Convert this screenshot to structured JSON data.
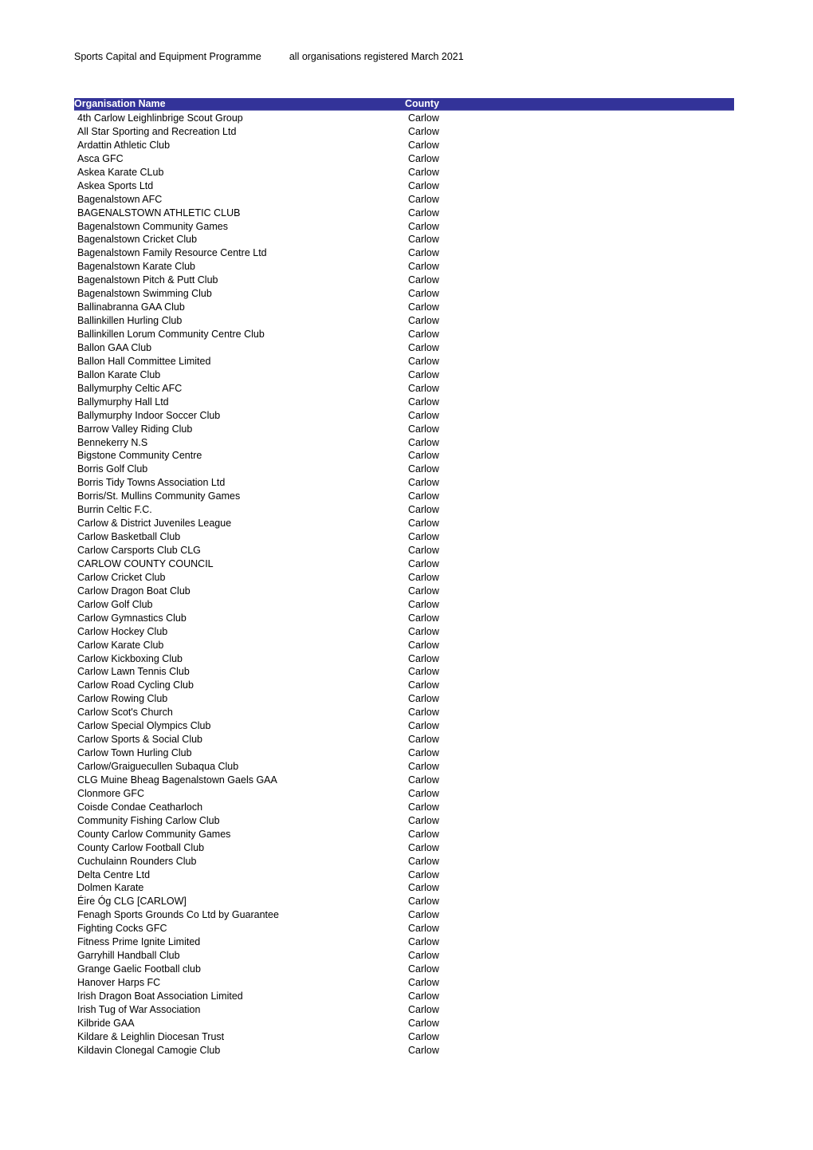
{
  "document": {
    "title_main": "Sports Capital and Equipment Programme",
    "title_sub": "all organisations registered March 2021",
    "accent_color": "#333399",
    "header_text_color": "#ffffff",
    "body_text_color": "#000000",
    "page_background": "#ffffff"
  },
  "table": {
    "columns": [
      {
        "key": "organisation",
        "label": "Organisation Name"
      },
      {
        "key": "county",
        "label": "County"
      }
    ],
    "row_count": 72,
    "rows": [
      {
        "organisation": "4th Carlow Leighlinbrige Scout Group",
        "county": "Carlow"
      },
      {
        "organisation": "All Star Sporting and Recreation Ltd",
        "county": "Carlow"
      },
      {
        "organisation": "Ardattin Athletic Club",
        "county": "Carlow"
      },
      {
        "organisation": "Asca GFC",
        "county": "Carlow"
      },
      {
        "organisation": "Askea Karate CLub",
        "county": "Carlow"
      },
      {
        "organisation": "Askea Sports Ltd",
        "county": "Carlow"
      },
      {
        "organisation": "Bagenalstown AFC",
        "county": "Carlow"
      },
      {
        "organisation": "BAGENALSTOWN ATHLETIC CLUB",
        "county": "Carlow"
      },
      {
        "organisation": "Bagenalstown Community Games",
        "county": "Carlow"
      },
      {
        "organisation": "Bagenalstown Cricket Club",
        "county": "Carlow"
      },
      {
        "organisation": "Bagenalstown Family Resource Centre Ltd",
        "county": "Carlow"
      },
      {
        "organisation": "Bagenalstown Karate Club",
        "county": "Carlow"
      },
      {
        "organisation": "Bagenalstown Pitch & Putt Club",
        "county": "Carlow"
      },
      {
        "organisation": "Bagenalstown Swimming Club",
        "county": "Carlow"
      },
      {
        "organisation": "Ballinabranna GAA Club",
        "county": "Carlow"
      },
      {
        "organisation": "Ballinkillen Hurling Club",
        "county": "Carlow"
      },
      {
        "organisation": "Ballinkillen Lorum Community Centre Club",
        "county": "Carlow"
      },
      {
        "organisation": "Ballon GAA Club",
        "county": "Carlow"
      },
      {
        "organisation": "Ballon Hall Committee Limited",
        "county": "Carlow"
      },
      {
        "organisation": "Ballon Karate Club",
        "county": "Carlow"
      },
      {
        "organisation": "Ballymurphy Celtic AFC",
        "county": "Carlow"
      },
      {
        "organisation": "Ballymurphy Hall Ltd",
        "county": "Carlow"
      },
      {
        "organisation": "Ballymurphy Indoor Soccer Club",
        "county": "Carlow"
      },
      {
        "organisation": "Barrow Valley Riding Club",
        "county": "Carlow"
      },
      {
        "organisation": "Bennekerry N.S",
        "county": "Carlow"
      },
      {
        "organisation": "Bigstone Community Centre",
        "county": "Carlow"
      },
      {
        "organisation": "Borris Golf Club",
        "county": "Carlow"
      },
      {
        "organisation": "Borris Tidy Towns Association Ltd",
        "county": "Carlow"
      },
      {
        "organisation": "Borris/St. Mullins Community Games",
        "county": "Carlow"
      },
      {
        "organisation": "Burrin Celtic F.C.",
        "county": "Carlow"
      },
      {
        "organisation": "Carlow & District Juveniles League",
        "county": "Carlow"
      },
      {
        "organisation": "Carlow Basketball Club",
        "county": "Carlow"
      },
      {
        "organisation": "Carlow Carsports Club CLG",
        "county": "Carlow"
      },
      {
        "organisation": "CARLOW COUNTY COUNCIL",
        "county": "Carlow"
      },
      {
        "organisation": "Carlow Cricket Club",
        "county": "Carlow"
      },
      {
        "organisation": "Carlow Dragon Boat Club",
        "county": "Carlow"
      },
      {
        "organisation": "Carlow Golf Club",
        "county": "Carlow"
      },
      {
        "organisation": "Carlow Gymnastics Club",
        "county": "Carlow"
      },
      {
        "organisation": "Carlow Hockey Club",
        "county": "Carlow"
      },
      {
        "organisation": "Carlow Karate Club",
        "county": "Carlow"
      },
      {
        "organisation": "Carlow Kickboxing Club",
        "county": "Carlow"
      },
      {
        "organisation": "Carlow Lawn Tennis Club",
        "county": "Carlow"
      },
      {
        "organisation": "Carlow Road Cycling Club",
        "county": "Carlow"
      },
      {
        "organisation": "Carlow Rowing Club",
        "county": "Carlow"
      },
      {
        "organisation": "Carlow Scot's Church",
        "county": "Carlow"
      },
      {
        "organisation": "Carlow Special Olympics Club",
        "county": "Carlow"
      },
      {
        "organisation": "Carlow Sports & Social Club",
        "county": "Carlow"
      },
      {
        "organisation": "Carlow Town Hurling Club",
        "county": "Carlow"
      },
      {
        "organisation": "Carlow/Graiguecullen Subaqua Club",
        "county": "Carlow"
      },
      {
        "organisation": "CLG Muine Bheag Bagenalstown Gaels GAA",
        "county": "Carlow"
      },
      {
        "organisation": "Clonmore GFC",
        "county": "Carlow"
      },
      {
        "organisation": "Coisde Condae Ceatharloch",
        "county": "Carlow"
      },
      {
        "organisation": "Community Fishing Carlow Club",
        "county": "Carlow"
      },
      {
        "organisation": "County Carlow Community Games",
        "county": "Carlow"
      },
      {
        "organisation": "County Carlow Football Club",
        "county": "Carlow"
      },
      {
        "organisation": "Cuchulainn Rounders Club",
        "county": "Carlow"
      },
      {
        "organisation": "Delta Centre Ltd",
        "county": "Carlow"
      },
      {
        "organisation": "Dolmen Karate",
        "county": "Carlow"
      },
      {
        "organisation": "Éire Óg CLG [CARLOW]",
        "county": "Carlow"
      },
      {
        "organisation": "Fenagh Sports Grounds Co Ltd by Guarantee",
        "county": "Carlow"
      },
      {
        "organisation": "Fighting Cocks GFC",
        "county": "Carlow"
      },
      {
        "organisation": "Fitness Prime Ignite Limited",
        "county": "Carlow"
      },
      {
        "organisation": "Garryhill Handball Club",
        "county": "Carlow"
      },
      {
        "organisation": "Grange Gaelic Football club",
        "county": "Carlow"
      },
      {
        "organisation": "Hanover Harps FC",
        "county": "Carlow"
      },
      {
        "organisation": "Irish Dragon Boat Association Limited",
        "county": "Carlow"
      },
      {
        "organisation": "Irish Tug of War Association",
        "county": "Carlow"
      },
      {
        "organisation": "Kilbride GAA",
        "county": "Carlow"
      },
      {
        "organisation": "Kildare & Leighlin Diocesan Trust",
        "county": "Carlow"
      },
      {
        "organisation": "Kildavin Clonegal Camogie Club",
        "county": "Carlow"
      }
    ]
  }
}
